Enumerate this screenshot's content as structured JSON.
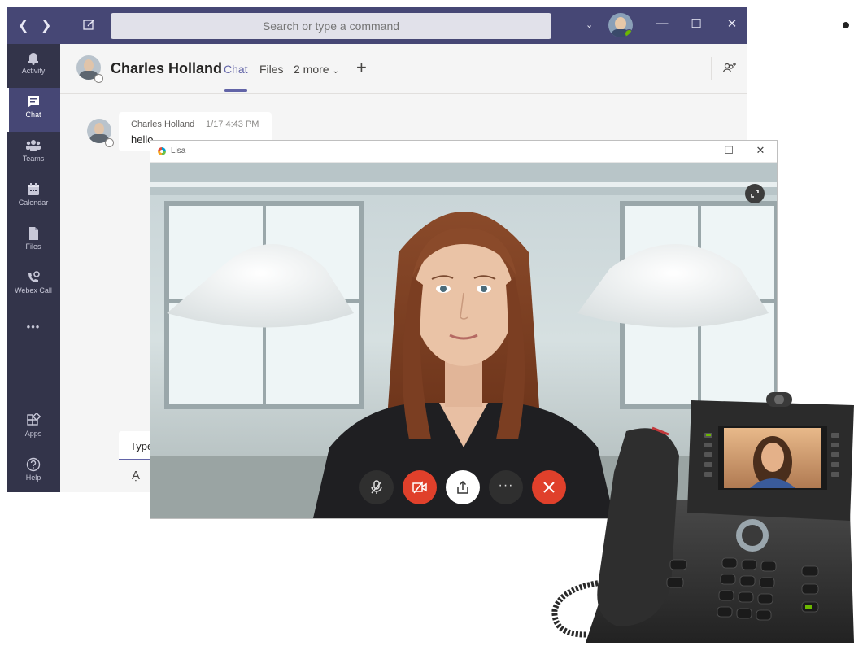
{
  "teams": {
    "search": {
      "placeholder": "Search or type a command"
    },
    "rail": [
      {
        "label": "Activity",
        "icon": "bell-icon"
      },
      {
        "label": "Chat",
        "icon": "chat-icon",
        "active": true
      },
      {
        "label": "Teams",
        "icon": "teams-icon"
      },
      {
        "label": "Calendar",
        "icon": "calendar-icon"
      },
      {
        "label": "Files",
        "icon": "files-icon"
      },
      {
        "label": "Webex Call",
        "icon": "webex-call-icon"
      },
      {
        "label": "Apps",
        "icon": "apps-icon"
      },
      {
        "label": "Help",
        "icon": "help-icon"
      }
    ],
    "more_glyph": "•••",
    "chat": {
      "contact_name": "Charles Holland",
      "tabs": [
        "Chat",
        "Files",
        "2 more"
      ],
      "message": {
        "author": "Charles Holland",
        "time": "1/17 4:43 PM",
        "text": "hello"
      },
      "compose_value": "Type"
    },
    "colors": {
      "titlebar": "#464775",
      "rail": "#33344a",
      "accent": "#6264a7"
    }
  },
  "call_window": {
    "title": "Lisa",
    "controls": [
      {
        "name": "mute",
        "icon": "mic-off-icon"
      },
      {
        "name": "stop-video",
        "icon": "video-off-icon"
      },
      {
        "name": "share",
        "icon": "share-icon"
      },
      {
        "name": "more",
        "icon": "more-icon",
        "glyph": "···"
      },
      {
        "name": "end-call",
        "icon": "end-call-icon"
      }
    ],
    "colors": {
      "end": "#e0402b"
    }
  }
}
